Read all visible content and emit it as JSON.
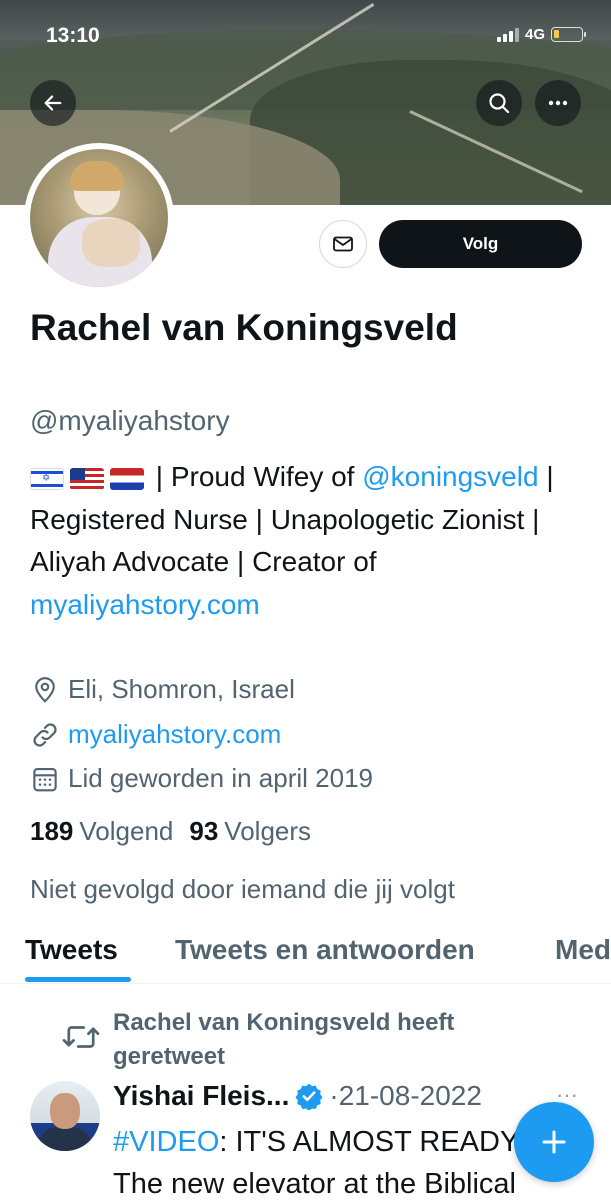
{
  "status_bar": {
    "time": "13:10",
    "network": "4G",
    "battery_level": 0.15
  },
  "header": {
    "back_icon": "arrow-left-icon",
    "search_icon": "search-icon",
    "more_icon": "more-horizontal-icon"
  },
  "profile": {
    "follow_label": "Volg",
    "name": "Rachel van Koningsveld",
    "handle": "@myaliyahstory",
    "bio": {
      "flags": [
        "Israel",
        "United States",
        "Netherlands"
      ],
      "text_1": " | Proud Wifey of ",
      "mention": "@koningsveld",
      "text_2": " | Registered Nurse | Unapologetic Zionist | Aliyah Advocate | Creator of ",
      "link": "myaliyahstory.com"
    },
    "location": "Eli, Shomron, Israel",
    "website": "myaliyahstory.com",
    "joined": "Lid geworden in april 2019",
    "following_count": "189",
    "following_label": "Volgend",
    "followers_count": "93",
    "followers_label": "Volgers",
    "not_followed": "Niet gevolgd door iemand die jij volgt"
  },
  "tabs": [
    {
      "label": "Tweets",
      "active": true
    },
    {
      "label": "Tweets en antwoorden",
      "active": false
    },
    {
      "label": "Media",
      "active": false
    }
  ],
  "tweet": {
    "retweet_label": "Rachel van Koningsveld heeft geretweet",
    "author": "Yishai Fleis...",
    "separator": "·",
    "date": "21-08-2022",
    "more": "···",
    "hashtag": "#VIDEO",
    "line_1": ": IT'S ALMOST READY",
    "line_2": "The new elevator at the Biblical"
  },
  "colors": {
    "accent": "#1d9bf0",
    "text": "#0f1419",
    "secondary": "#536471"
  }
}
